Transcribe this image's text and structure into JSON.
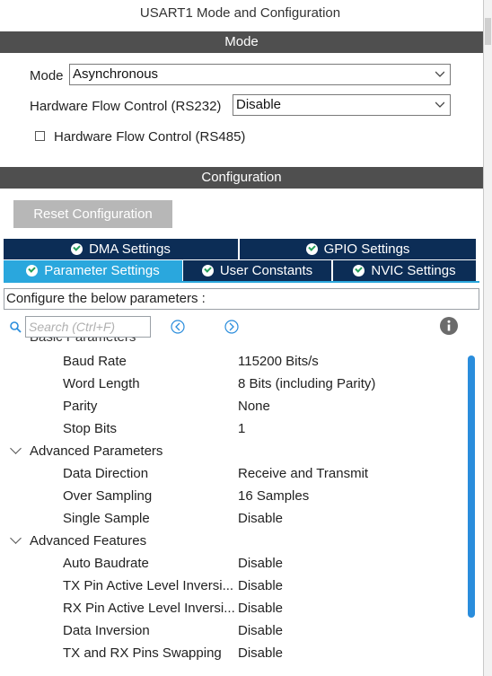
{
  "window": {
    "title": "USART1 Mode and Configuration"
  },
  "mode_section": {
    "header": "Mode",
    "mode_label": "Mode",
    "mode_value": "Asynchronous",
    "flow_rs232_label": "Hardware Flow Control (RS232)",
    "flow_rs232_value": "Disable",
    "flow_rs485_label": "Hardware Flow Control (RS485)",
    "flow_rs485_checked": false
  },
  "config_section": {
    "header": "Configuration",
    "reset_button": "Reset Configuration",
    "tabs_row1": [
      "DMA Settings",
      "GPIO Settings"
    ],
    "tabs_row2": [
      "Parameter Settings",
      "User Constants",
      "NVIC Settings"
    ],
    "active_tab": "Parameter Settings",
    "hint": "Configure the below parameters :",
    "search_placeholder": "Search (Ctrl+F)"
  },
  "params": {
    "basic_header_partial": "Basic Parameters",
    "basic": [
      {
        "name": "Baud Rate",
        "value": "115200 Bits/s"
      },
      {
        "name": "Word Length",
        "value": "8 Bits (including Parity)"
      },
      {
        "name": "Parity",
        "value": "None"
      },
      {
        "name": "Stop Bits",
        "value": "1"
      }
    ],
    "advanced_header": "Advanced Parameters",
    "advanced": [
      {
        "name": "Data Direction",
        "value": "Receive and Transmit"
      },
      {
        "name": "Over Sampling",
        "value": "16 Samples"
      },
      {
        "name": "Single Sample",
        "value": "Disable"
      }
    ],
    "features_header": "Advanced Features",
    "features": [
      {
        "name": "Auto Baudrate",
        "value": "Disable"
      },
      {
        "name": "TX Pin Active Level Inversi...",
        "value": "Disable"
      },
      {
        "name": "RX Pin Active Level Inversi...",
        "value": "Disable"
      },
      {
        "name": "Data Inversion",
        "value": "Disable"
      },
      {
        "name": "TX and RX Pins Swapping",
        "value": "Disable"
      }
    ]
  },
  "colors": {
    "section_bar": "#4f4f4f",
    "tab_dark": "#0c2d56",
    "tab_active": "#2aa7dd",
    "scroll_thumb": "#2a8ddc",
    "check_green": "#24a05a"
  }
}
